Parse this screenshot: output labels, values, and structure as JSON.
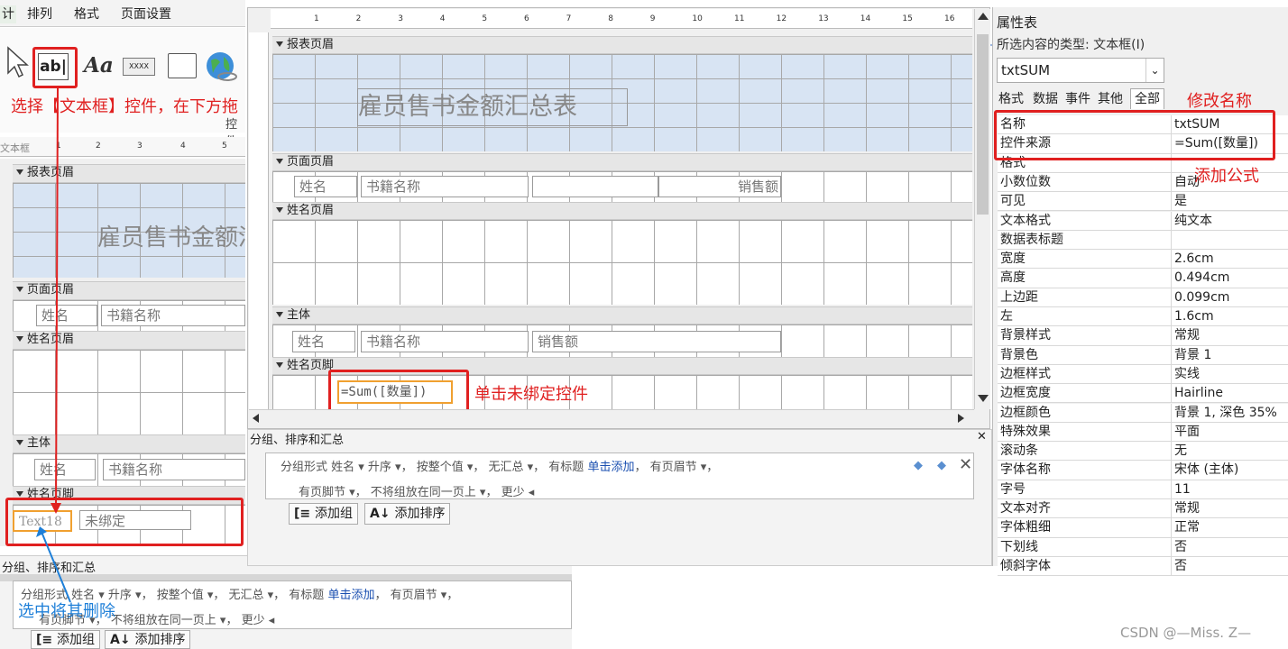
{
  "ribbon": {
    "tabs": [
      "计",
      "排列",
      "格式",
      "页面设置"
    ],
    "toolbox_tip": "控件",
    "text_icon_label": "ab|",
    "label_icon_label": "Aa",
    "btn_icon_label": "XXXX"
  },
  "left_panel": {
    "ruler_label": "文本框",
    "ruler_marks": [
      "1",
      "2",
      "3",
      "4",
      "5"
    ],
    "bands": {
      "report_header": "报表页眉",
      "page_header": "页面页眉",
      "name_header": "姓名页眉",
      "detail": "主体",
      "name_footer": "姓名页脚"
    },
    "title": "雇员售书金额汇总表",
    "page_header_boxes": [
      "姓名",
      "书籍名称"
    ],
    "detail_boxes": [
      "姓名",
      "书籍名称"
    ],
    "footer_text18": "Text18",
    "footer_unbound": "未绑定",
    "group_panel_title": "分组、排序和汇总",
    "group_row1": {
      "a": "分组形式 姓名 ▾ 升序 ▾， 按整个值 ▾， 无汇总 ▾， 有标题 ",
      "link": "单击添加",
      "b": "， 有页眉节 ▾，"
    },
    "group_row2": "有页脚节 ▾， 不将组放在同一页上 ▾， 更少 ◂",
    "add_group": "添加组",
    "add_sort": "添加排序"
  },
  "center_panel": {
    "ruler_marks": [
      "1",
      "2",
      "3",
      "4",
      "5",
      "6",
      "7",
      "8",
      "9",
      "10",
      "11",
      "12",
      "13",
      "14",
      "15",
      "16"
    ],
    "bands": {
      "report_header": "报表页眉",
      "page_header": "页面页眉",
      "name_header": "姓名页眉",
      "detail": "主体",
      "name_footer": "姓名页脚"
    },
    "title": "雇员售书金额汇总表",
    "page_header_boxes": [
      "姓名",
      "书籍名称",
      "",
      "销售额"
    ],
    "detail_boxes": [
      "姓名",
      "书籍名称",
      "销售额"
    ],
    "footer_formula": "=Sum([数量])",
    "group_panel_title": "分组、排序和汇总",
    "group_row1": {
      "a": "分组形式 姓名 ▾ 升序 ▾， 按整个值 ▾， 无汇总 ▾， 有标题 ",
      "link": "单击添加",
      "b": "， 有页眉节 ▾，"
    },
    "group_row2": "有页脚节 ▾， 不将组放在同一页上 ▾， 更少 ◂",
    "add_group": "添加组",
    "add_sort": "添加排序"
  },
  "annotations": {
    "select_textbox": "选择【文本框】控件，在下方拖",
    "click_unbound": "单击未绑定控件",
    "select_delete": "选中将其删除",
    "rename": "修改名称",
    "add_formula": "添加公式"
  },
  "property_sheet": {
    "title": "属性表",
    "selection_type": "所选内容的类型: 文本框(I)",
    "combo_value": "txtSUM",
    "tabs": [
      "格式",
      "数据",
      "事件",
      "其他",
      "全部"
    ],
    "rows": [
      [
        "名称",
        "txtSUM"
      ],
      [
        "控件来源",
        "=Sum([数量])"
      ],
      [
        "格式",
        ""
      ],
      [
        "小数位数",
        "自动"
      ],
      [
        "可见",
        "是"
      ],
      [
        "文本格式",
        "纯文本"
      ],
      [
        "数据表标题",
        ""
      ],
      [
        "宽度",
        "2.6cm"
      ],
      [
        "高度",
        "0.494cm"
      ],
      [
        "上边距",
        "0.099cm"
      ],
      [
        "左",
        "1.6cm"
      ],
      [
        "背景样式",
        "常规"
      ],
      [
        "背景色",
        "背景 1"
      ],
      [
        "边框样式",
        "实线"
      ],
      [
        "边框宽度",
        "Hairline"
      ],
      [
        "边框颜色",
        "背景 1, 深色 35%"
      ],
      [
        "特殊效果",
        "平面"
      ],
      [
        "滚动条",
        "无"
      ],
      [
        "字体名称",
        "宋体 (主体)"
      ],
      [
        "字号",
        "11"
      ],
      [
        "文本对齐",
        "常规"
      ],
      [
        "字体粗细",
        "正常"
      ],
      [
        "下划线",
        "否"
      ],
      [
        "倾斜字体",
        "否"
      ]
    ]
  },
  "watermark": "CSDN @—Miss. Z—"
}
